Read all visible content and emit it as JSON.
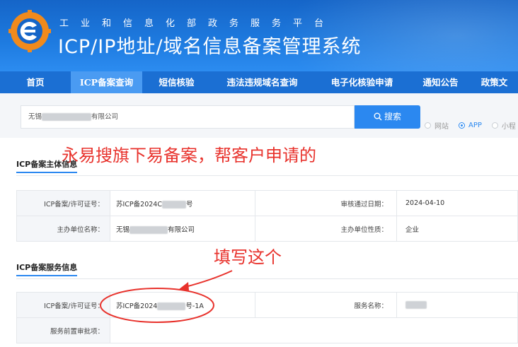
{
  "header": {
    "subtitle": "工业和信息化部政务服务平台",
    "title": "ICP/IP地址/域名信息备案管理系统",
    "colors": {
      "primary": "#1b6fd3",
      "active_tab": "#4a9bf2",
      "annotation": "#e8322c"
    }
  },
  "nav": {
    "items": [
      {
        "label": "首页"
      },
      {
        "label": "ICP备案查询",
        "active": true
      },
      {
        "label": "短信核验"
      },
      {
        "label": "违法违规域名查询"
      },
      {
        "label": "电子化核验申请"
      },
      {
        "label": "通知公告"
      },
      {
        "label": "政策文"
      }
    ]
  },
  "search": {
    "value_prefix": "无锡",
    "value_suffix": "有限公司",
    "button_label": "搜索",
    "button_icon": "search-icon",
    "options": [
      {
        "label": "网站",
        "checked": false
      },
      {
        "label": "APP",
        "checked": true
      },
      {
        "label": "小程",
        "checked": false
      }
    ]
  },
  "annotations": {
    "top_note": "永易搜旗下易备案，帮客户申请的",
    "fill_note": "填写这个"
  },
  "entity_section": {
    "title": "ICP备案主体信息",
    "rows": [
      {
        "label": "ICP备案/许可证号：",
        "value_prefix": "苏ICP备2024C",
        "value_suffix": "号",
        "label2": "审核通过日期：",
        "value2": "2024-04-10"
      },
      {
        "label": "主办单位名称：",
        "value_prefix": "无锡",
        "value_suffix": "有限公司",
        "label2": "主办单位性质：",
        "value2": "企业"
      }
    ]
  },
  "service_section": {
    "title": "ICP备案服务信息",
    "rows": [
      {
        "label": "ICP备案/许可证号：",
        "value_prefix": "苏ICP备2024",
        "value_suffix": "号-1A",
        "label2": "服务名称：",
        "value2": ""
      },
      {
        "label": "服务前置审批项：",
        "value_prefix": "",
        "value_suffix": "",
        "label2": "",
        "value2": ""
      }
    ]
  }
}
